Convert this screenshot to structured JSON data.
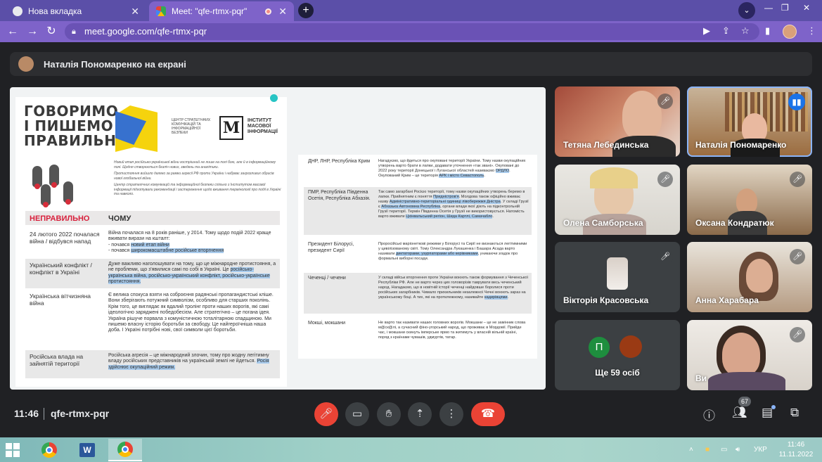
{
  "browser": {
    "tabs": [
      {
        "title": "Нова вкладка",
        "active": false
      },
      {
        "title": "Meet: \"qfe-rtmx-pqr\"",
        "active": true
      }
    ],
    "url": "meet.google.com/qfe-rtmx-pqr",
    "accent": "#7e63c9"
  },
  "meet": {
    "presenting_label": "Наталія Пономаренко на екрані",
    "time": "11:46",
    "meeting_code": "qfe-rtmx-pqr",
    "people_count": "67",
    "participants": [
      {
        "name": "Тетяна Лебединська",
        "muted": true
      },
      {
        "name": "Наталія Пономаренко",
        "speaking": true
      },
      {
        "name": "Олена Самборська",
        "muted": true
      },
      {
        "name": "Оксана Кондратюк",
        "muted": true
      },
      {
        "name": "Вікторія Красовська",
        "muted": true
      },
      {
        "name": "Анна Харабара",
        "muted": true
      },
      {
        "name": "Ще 59 осіб",
        "avatar_letter": "П"
      },
      {
        "name": "Ви",
        "muted": true
      }
    ]
  },
  "slide": {
    "title_lines": [
      "ГОВОРИМО",
      "І ПИШЕМО",
      "ПРАВИЛЬНО"
    ],
    "org_ccb": "Центр стратегічних комунікацій та інформаційної безпеки",
    "imi_letter": "М",
    "imi_name": "Інститут масової інформації",
    "intro_1": "Новий етап російсько-української війни гострішний не лише на полі бою, але й в інформаційному полі. Щодня створюється безліч нових, зведень та аналітики.",
    "intro_2": "Протистояння вийшло далеко за рамки агресії РФ проти України і набуває загрозливих обрисів нової глобальної війни.",
    "intro_3": "Центр стратегічних комунікацій та інформаційної безпеки спільно з Інститутом масової інформації підготували рекомендації і застереження щодо вживання термінології про події в Україні та навколо.",
    "header_wrong": "НЕПРАВИЛЬНО",
    "header_why": "ЧОМУ",
    "left_rows": [
      {
        "term": "24 лютого 2022 почалася війна / відбувся напад",
        "desc_parts": [
          "Війна почалася на 8 років раніше, у 2014. Тому щодо подій 2022 краще вживати вирази на кшталт:",
          "- почався ",
          "новий етап війни",
          "- почався ",
          "широкомасштабне російське вторгнення"
        ]
      },
      {
        "term": "Український конфлікт / конфлікт в Україні",
        "desc_parts": [
          "Дуже важливо наголошувати на тому, що це міжнародне протистояння, а не проблеми, що з'явилися самі по собі в Україні. Це ",
          "російсько-українська війна, російсько-український конфлікт, російсько-українське протистояння."
        ]
      },
      {
        "term": "Українська вітчизняна війна",
        "desc": "Є велика спокуса взяти на озброєння радянські пропагандистські кліше. Вони зберігають потужний символізм, особливо для старших поколінь. Крім того, це виглядає як вдалий тролінг проти наших ворогів, які самі ідеологічно заряджені победобесієм. Але стратегічно – це погана ідея. Україна рішуче порвала з комуністичною тоталітарною спадщиною. Ми пишемо власну історію боротьби за свободу. Це найгероїчніша наша доба. І Україні потрібні нові, свої символи цієї боротьби."
      },
      {
        "term": "Російська влада на зайнятій території",
        "desc_parts": [
          "Російська агресія – це міжнародний злочин, тому про жодну легітимну владу російських представників на українській землі не йдеться. ",
          "Росія здійснює окупаційний режим."
        ]
      }
    ],
    "right_rows": [
      {
        "term": "ДНР, ЛНР, Республіка Крим",
        "desc_parts": [
          "Нагадуємо, що йдеться про окуповані території України. Тому назви окупаційних утворень варто брати в лапки, додавати уточнення «так звані». Окуповані до 2022 року території Донецької і Луганської областей називаємо ",
          "ОРДЛО",
          ". Окупований Крим – це територія ",
          "АРК і місто Севастополь",
          "."
        ]
      },
      {
        "term": "ПМР, Республіка Південна Осетія, Республіка Абхазія.",
        "desc_parts": [
          "Так само загарбані Росією території, тому назви окупаційних утворень беремо в лапки. Прийнятним є поняття ",
          "Придністров'я",
          ". Молдова також офіційно вживає назву ",
          "Адміністративно-територіальні одиниці лівобережжя Дністра",
          ". У складі Грузії є ",
          "Абхазька Автономна Республіка",
          ", органи влади якої діють на підконтрольній Грузії території. Термін Південна Осетія у Грузії не використовується. Натомість варто вживати ",
          "Цхінвальський регіон, Шида Картлі, Самачабло",
          "."
        ]
      },
      {
        "term": "Президент Білорусі, президент Сирії",
        "desc_parts": [
          "Проросійські маріонеткові режими у Білорусі та Сирії не визнаються легітимними у цивілізованому світі. Тому Олександра Лукашенка і Башара Асада варто називати ",
          "диктаторами, узурпаторами або керівниками",
          ", уникаючи згадок про формальні виборні посади."
        ]
      },
      {
        "term": "Чеченці / чечени",
        "desc_parts": [
          "У складі військ вторгнення проти України воюють також формування з Чеченської Республіки РФ. Але не варто через цих головорізів таврувати весь чеченський народ. Нагадаємо, що в новітній історії чеченці найдовше боролися проти російських загарбників. Чимало прихильників незалежної Чечні воюють зараз на українському боці. А тих, які на протилежному, називайте ",
          "кадирівцями",
          "."
        ]
      },
      {
        "term": "Мокші, мокшани",
        "desc": "Не варто так називати наших головних ворогів. Мокшани – це не замінник слова м@ск@лі, а сучасний фіно-угорський народ, що проживає в Мордовії. Прийде час, і мокшани скинуть імперське ярмо та житимуть у власній вільній країні, поряд з країнами чувашів, удмуртів, татар."
      }
    ]
  },
  "taskbar": {
    "language": "УКР",
    "time": "11:46",
    "date": "11.11.2022"
  }
}
